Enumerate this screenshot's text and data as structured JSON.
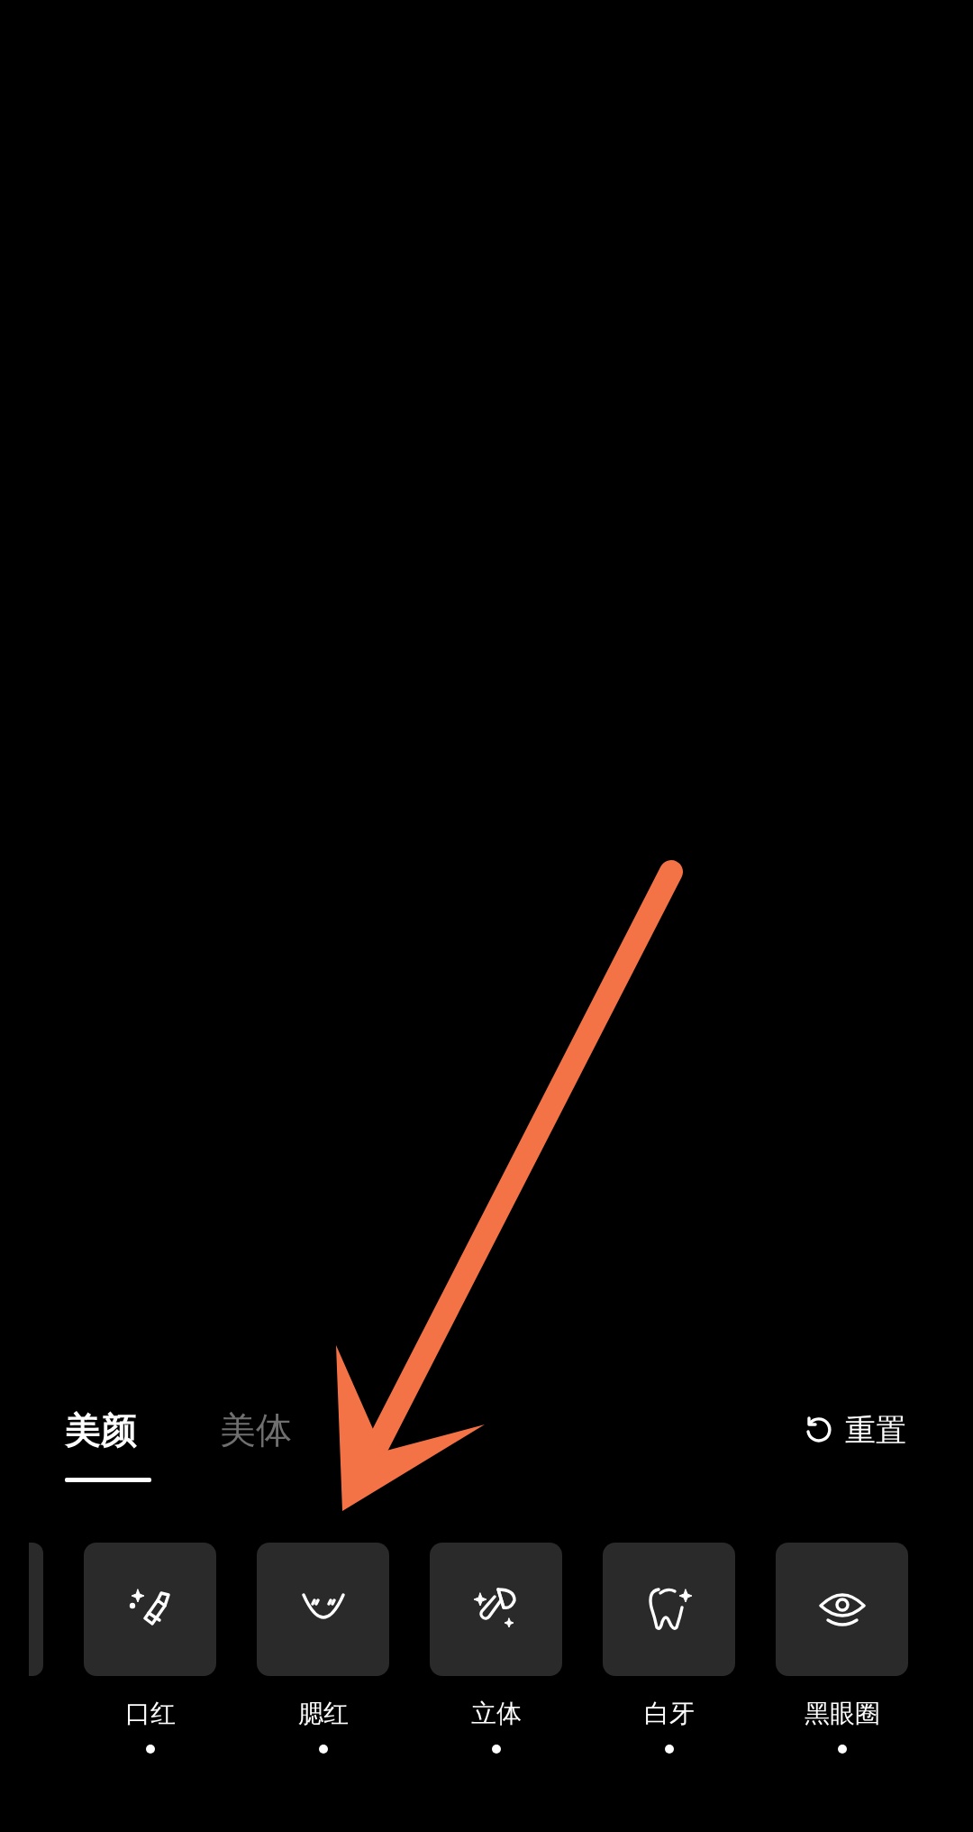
{
  "tabs": [
    {
      "label": "美颜",
      "selected": true
    },
    {
      "label": "美体",
      "selected": false
    }
  ],
  "reset": {
    "label": "重置"
  },
  "items": [
    {
      "label": "口红",
      "modified": true
    },
    {
      "label": "腮红",
      "modified": true
    },
    {
      "label": "立体",
      "modified": true
    },
    {
      "label": "白牙",
      "modified": true
    },
    {
      "label": "黑眼圈",
      "modified": true
    }
  ]
}
